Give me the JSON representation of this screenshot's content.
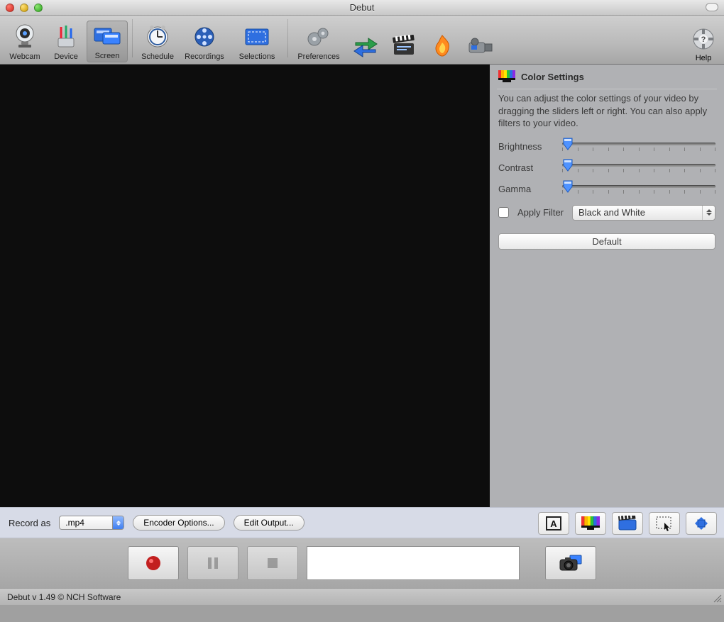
{
  "window": {
    "title": "Debut"
  },
  "toolbar": {
    "webcam": "Webcam",
    "device": "Device",
    "screen": "Screen",
    "schedule": "Schedule",
    "recordings": "Recordings",
    "selections": "Selections",
    "preferences": "Preferences",
    "help": "Help"
  },
  "side": {
    "title": "Color Settings",
    "desc": "You can adjust the color settings of your video by dragging the sliders left or right. You can also apply filters to your video.",
    "brightness_label": "Brightness",
    "contrast_label": "Contrast",
    "gamma_label": "Gamma",
    "apply_filter_label": "Apply Filter",
    "filter_value": "Black and White",
    "default_label": "Default"
  },
  "recbar": {
    "record_as_label": "Record as",
    "format_value": ".mp4",
    "encoder_btn": "Encoder Options...",
    "edit_output_btn": "Edit Output..."
  },
  "status": {
    "text": "Debut v 1.49 © NCH Software"
  }
}
